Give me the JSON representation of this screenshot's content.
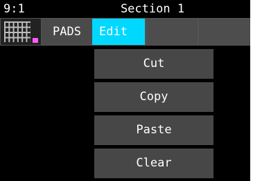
{
  "status": {
    "left": "9:1",
    "title": "Section 1"
  },
  "tabs": {
    "pads": "PADS",
    "edit": "Edit"
  },
  "menu": {
    "items": [
      "Cut",
      "Copy",
      "Paste",
      "Clear"
    ]
  },
  "colors": {
    "active_tab": "#00d8ff",
    "pad_marker": "#ff5bff",
    "menu_bg": "#474747"
  }
}
